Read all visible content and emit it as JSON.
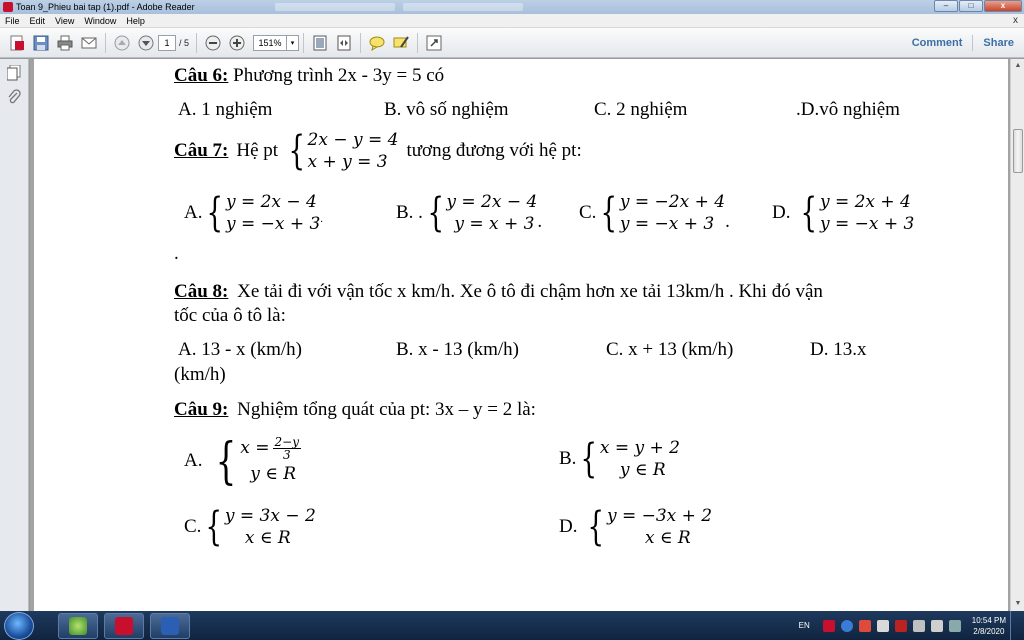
{
  "window": {
    "title": "Toan 9_Phieu bai tap (1).pdf - Adobe Reader",
    "minimize": "–",
    "maximize": "□",
    "close": "x"
  },
  "menu": {
    "items": [
      "File",
      "Edit",
      "View",
      "Window",
      "Help"
    ],
    "close": "x"
  },
  "toolbar": {
    "page_current": "1",
    "page_total": "/ 5",
    "zoom": "151%",
    "comment": "Comment",
    "share": "Share"
  },
  "document": {
    "q6": {
      "label": "Câu 6:",
      "text": "Phương trình 2x - 3y = 5 có"
    },
    "q6_options": [
      "A. 1 nghiệm",
      "B. vô số nghiệm",
      "C. 2 nghiệm",
      ".D.vô nghiệm"
    ],
    "q7": {
      "label": "Câu 7:",
      "prefix": "Hệ pt",
      "sys_l1": "2x − y = 4",
      "sys_l2": "x + y = 3",
      "suffix": "tương đương với hệ pt:"
    },
    "q7_options": [
      {
        "letter": "A.",
        "l1": "y = 2x − 4",
        "l2": "y = −x + 3",
        "end": "."
      },
      {
        "letter": "B. .",
        "l1": "y = 2x − 4",
        "l2": "y = x + 3",
        "end": "."
      },
      {
        "letter": "C.",
        "l1": "y = −2x + 4",
        "l2": "y = −x + 3",
        "end": "."
      },
      {
        "letter": "D.",
        "l1": "y = 2x + 4",
        "l2": "y = −x + 3",
        "end": ""
      }
    ],
    "q7_trailing": ".",
    "q8": {
      "label": "Câu 8:",
      "line1": "Xe tải đi với vận tốc x km/h. Xe ô tô đi chậm hơn xe tải 13km/h . Khi đó vận",
      "line2": "tốc của  ô tô là:"
    },
    "q8_options": [
      "A. 13 - x (km/h)",
      "B. x - 13 (km/h)",
      "C. x + 13 (km/h)",
      "D. 13.x"
    ],
    "q8_wrap": "(km/h)",
    "q9": {
      "label": "Câu 9:",
      "text": "Nghiệm tổng quát của pt: 3x – y = 2 là:"
    },
    "q9_options": [
      {
        "letter": "A.",
        "l1_lhs": "x =",
        "num": "2−y",
        "den": "3",
        "l2": "y ∈ R"
      },
      {
        "letter": "B.",
        "l1": "x = y + 2",
        "l2": "y ∈ R"
      },
      {
        "letter": "C.",
        "l1": "y = 3x − 2",
        "l2": "x ∈ R"
      },
      {
        "letter": "D.",
        "l1": "y = −3x + 2",
        "l2": "x ∈ R"
      }
    ]
  },
  "taskbar": {
    "lang": "EN",
    "time": "10:54 PM",
    "date": "2/8/2020"
  }
}
